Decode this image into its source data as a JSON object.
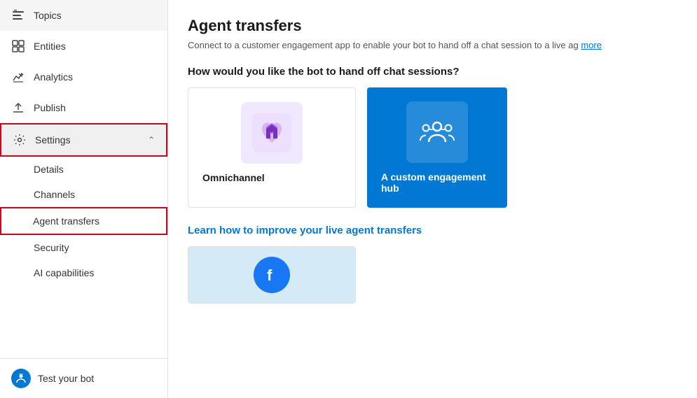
{
  "sidebar": {
    "items": [
      {
        "id": "topics",
        "label": "Topics",
        "icon": "topics-icon",
        "hasChildren": false
      },
      {
        "id": "entities",
        "label": "Entities",
        "icon": "entities-icon",
        "hasChildren": false
      },
      {
        "id": "analytics",
        "label": "Analytics",
        "icon": "analytics-icon",
        "hasChildren": false
      },
      {
        "id": "publish",
        "label": "Publish",
        "icon": "publish-icon",
        "hasChildren": false
      },
      {
        "id": "settings",
        "label": "Settings",
        "icon": "settings-icon",
        "hasChildren": true,
        "expanded": true
      }
    ],
    "sub_items": [
      {
        "id": "details",
        "label": "Details",
        "active": false
      },
      {
        "id": "channels",
        "label": "Channels",
        "active": false
      },
      {
        "id": "agent-transfers",
        "label": "Agent transfers",
        "active": true
      },
      {
        "id": "security",
        "label": "Security",
        "active": false
      },
      {
        "id": "ai-capabilities",
        "label": "AI capabilities",
        "active": false
      }
    ],
    "test_bot_label": "Test your bot"
  },
  "main": {
    "title": "Agent transfers",
    "subtitle": "Connect to a customer engagement app to enable your bot to hand off a chat session to a live ag",
    "learn_more_text": "more",
    "section_question": "How would you like the bot to hand off chat sessions?",
    "cards": [
      {
        "id": "omnichannel",
        "label": "Omnichannel"
      },
      {
        "id": "custom-hub",
        "label": "A custom engagement hub"
      }
    ],
    "learn_section_title": "Learn how to improve your live agent transfers"
  }
}
